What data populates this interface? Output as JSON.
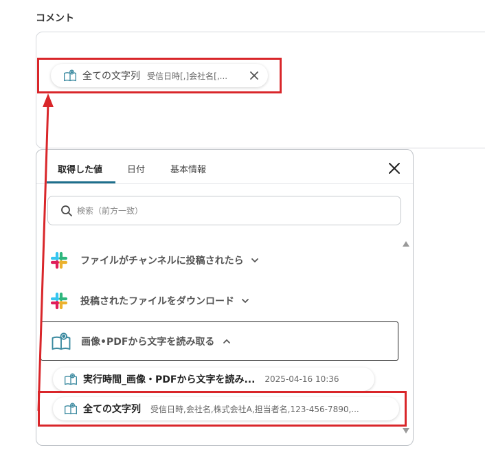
{
  "comment_label": "コメント",
  "input_chip": {
    "name": "全ての文字列",
    "value": "受信日時[,]会社名[,..."
  },
  "panel": {
    "tabs": [
      {
        "label": "取得した値",
        "active": true
      },
      {
        "label": "日付",
        "active": false
      },
      {
        "label": "基本情報",
        "active": false
      }
    ],
    "search_placeholder": "検索（前方一致）",
    "sections": [
      {
        "label": "ファイルがチャンネルに投稿されたら",
        "icon": "slack-icon"
      },
      {
        "label": "投稿されたファイルをダウンロード",
        "icon": "slack-icon"
      },
      {
        "label": "画像•PDFから文字を読み取る",
        "icon": "book-eye-icon",
        "expanded": true
      }
    ],
    "results": [
      {
        "name": "実行時間_画像・PDFから文字を読み...",
        "value": "2025-04-16 10:36"
      },
      {
        "name": "全ての文字列",
        "value": "受信日時,会社名,株式会社A,担当者名,123-456-7890,..."
      }
    ]
  },
  "colors": {
    "highlight": "#d9262a",
    "tab_accent": "#1e6f8c",
    "icon_teal": "#3b8aa0"
  }
}
